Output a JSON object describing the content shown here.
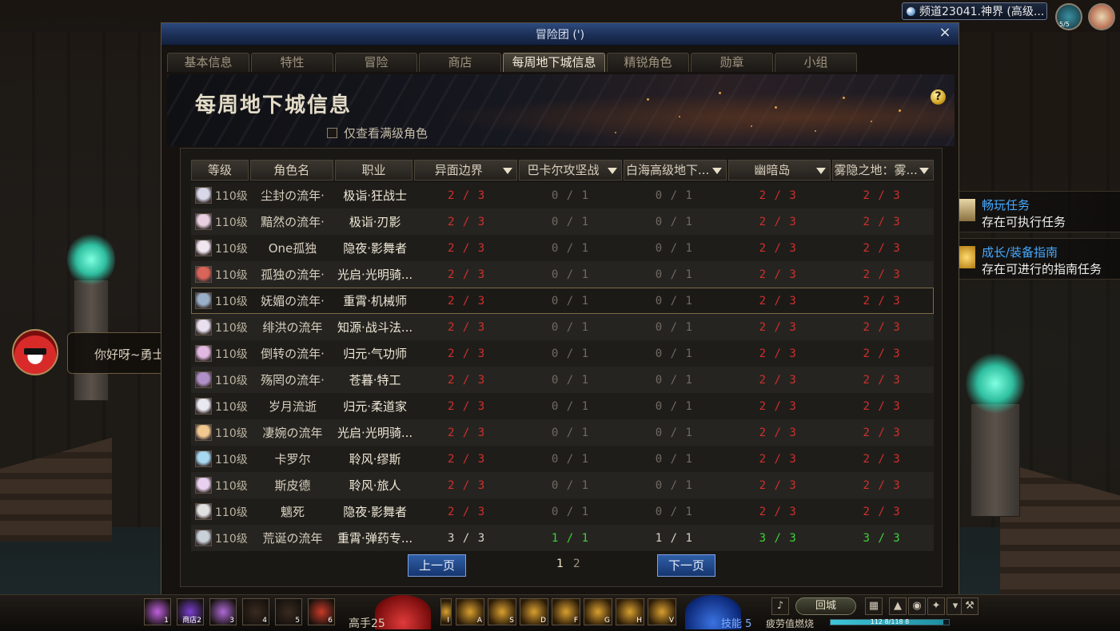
{
  "window": {
    "title": "冒险团 (')",
    "close": "×",
    "tabs": [
      "基本信息",
      "特性",
      "冒险",
      "商店",
      "每周地下城信息",
      "精锐角色",
      "勋章",
      "小组"
    ],
    "active_tab": 4
  },
  "panel": {
    "title": "每周地下城信息",
    "help": "?",
    "filter_label": "仅查看满级角色",
    "filter_checked": false
  },
  "table": {
    "headers": [
      "等级",
      "角色名",
      "职业",
      "异面边界",
      "巴卡尔攻坚战",
      "白海高级地下...",
      "幽暗岛",
      "雾隐之地：雾..."
    ],
    "rows": [
      {
        "level": "110级",
        "name": "尘封の流年·",
        "job": "极诣·狂战士",
        "d": [
          "2 / 3",
          "0 / 1",
          "0 / 1",
          "2 / 3",
          "2 / 3"
        ],
        "s": [
          "red",
          "grey",
          "grey",
          "red",
          "red"
        ],
        "avatar": "#d8d8e8"
      },
      {
        "level": "110级",
        "name": "黯然の流年·",
        "job": "极诣·刃影",
        "d": [
          "2 / 3",
          "0 / 1",
          "0 / 1",
          "2 / 3",
          "2 / 3"
        ],
        "s": [
          "red",
          "grey",
          "grey",
          "red",
          "red"
        ],
        "avatar": "#e8d0e0"
      },
      {
        "level": "110级",
        "name": "One孤独",
        "job": "隐夜·影舞者",
        "d": [
          "2 / 3",
          "0 / 1",
          "0 / 1",
          "2 / 3",
          "2 / 3"
        ],
        "s": [
          "red",
          "grey",
          "grey",
          "red",
          "red"
        ],
        "avatar": "#f0e6f0"
      },
      {
        "level": "110级",
        "name": "孤独の流年·",
        "job": "光启·光明骑...",
        "d": [
          "2 / 3",
          "0 / 1",
          "0 / 1",
          "2 / 3",
          "2 / 3"
        ],
        "s": [
          "red",
          "grey",
          "grey",
          "red",
          "red"
        ],
        "avatar": "#d9645a"
      },
      {
        "level": "110级",
        "name": "妩媚の流年·",
        "job": "重霄·机械师",
        "d": [
          "2 / 3",
          "0 / 1",
          "0 / 1",
          "2 / 3",
          "2 / 3"
        ],
        "s": [
          "red",
          "grey",
          "grey",
          "red",
          "red"
        ],
        "avatar": "#9ab0c8",
        "highlight": true
      },
      {
        "level": "110级",
        "name": "绯洪の流年",
        "job": "知源·战斗法...",
        "d": [
          "2 / 3",
          "0 / 1",
          "0 / 1",
          "2 / 3",
          "2 / 3"
        ],
        "s": [
          "red",
          "grey",
          "grey",
          "red",
          "red"
        ],
        "avatar": "#e8e0ee"
      },
      {
        "level": "110级",
        "name": "倒转の流年·",
        "job": "归元·气功师",
        "d": [
          "2 / 3",
          "0 / 1",
          "0 / 1",
          "2 / 3",
          "2 / 3"
        ],
        "s": [
          "red",
          "grey",
          "grey",
          "red",
          "red"
        ],
        "avatar": "#e0b8e0"
      },
      {
        "level": "110级",
        "name": "殇罔の流年·",
        "job": "苍暮·特工",
        "d": [
          "2 / 3",
          "0 / 1",
          "0 / 1",
          "2 / 3",
          "2 / 3"
        ],
        "s": [
          "red",
          "grey",
          "grey",
          "red",
          "red"
        ],
        "avatar": "#b090c8"
      },
      {
        "level": "110级",
        "name": "岁月流逝",
        "job": "归元·柔道家",
        "d": [
          "2 / 3",
          "0 / 1",
          "0 / 1",
          "2 / 3",
          "2 / 3"
        ],
        "s": [
          "red",
          "grey",
          "grey",
          "red",
          "red"
        ],
        "avatar": "#e8e8f0"
      },
      {
        "level": "110级",
        "name": "凄婉の流年",
        "job": "光启·光明骑...",
        "d": [
          "2 / 3",
          "0 / 1",
          "0 / 1",
          "2 / 3",
          "2 / 3"
        ],
        "s": [
          "red",
          "grey",
          "grey",
          "red",
          "red"
        ],
        "avatar": "#f0c890"
      },
      {
        "level": "110级",
        "name": "卡罗尔",
        "job": "聆风·缪斯",
        "d": [
          "2 / 3",
          "0 / 1",
          "0 / 1",
          "2 / 3",
          "2 / 3"
        ],
        "s": [
          "red",
          "grey",
          "grey",
          "red",
          "red"
        ],
        "avatar": "#a8d8f0"
      },
      {
        "level": "110级",
        "name": "斯皮德",
        "job": "聆风·旅人",
        "d": [
          "2 / 3",
          "0 / 1",
          "0 / 1",
          "2 / 3",
          "2 / 3"
        ],
        "s": [
          "red",
          "grey",
          "grey",
          "red",
          "red"
        ],
        "avatar": "#e8d0f0"
      },
      {
        "level": "110级",
        "name": "魑死",
        "job": "隐夜·影舞者",
        "d": [
          "2 / 3",
          "0 / 1",
          "0 / 1",
          "2 / 3",
          "2 / 3"
        ],
        "s": [
          "red",
          "grey",
          "grey",
          "red",
          "red"
        ],
        "avatar": "#e0e0e0"
      },
      {
        "level": "110级",
        "name": "荒诞の流年",
        "job": "重霄·弹药专...",
        "d": [
          "3 / 3",
          "1 / 1",
          "1 / 1",
          "3 / 3",
          "3 / 3"
        ],
        "s": [
          "white",
          "green",
          "white",
          "green",
          "green"
        ],
        "avatar": "#c8d0d8"
      }
    ]
  },
  "pager": {
    "prev": "上一页",
    "next": "下一页",
    "pages": [
      "1",
      "2"
    ],
    "current": 0
  },
  "channel": {
    "text": "频道23041.神界 (高级..."
  },
  "fatigue_badge": "5/5",
  "npc_chat": "你好呀~勇士!",
  "notices": [
    {
      "title": "畅玩任务",
      "desc": "存在可执行任务"
    },
    {
      "title": "成长/装备指南",
      "desc": "存在可进行的指南任务"
    }
  ],
  "hotbar": {
    "left_keys": [
      "1",
      "商店2",
      "3",
      "4",
      "5",
      "6"
    ],
    "mid_keys": [
      "I",
      "A",
      "S",
      "D",
      "F",
      "G",
      "H",
      "V"
    ],
    "level": "高手25",
    "skill": "技能  5",
    "town": "回城",
    "fatigue": "疲劳值燃烧",
    "exp_text": "112 8/118 8",
    "exp_fraction": 0.95
  },
  "colors": {
    "red": "#d0302c",
    "green": "#3bd43b",
    "grey": "#6f6a62",
    "accent_blue": "#2f5fa8"
  }
}
